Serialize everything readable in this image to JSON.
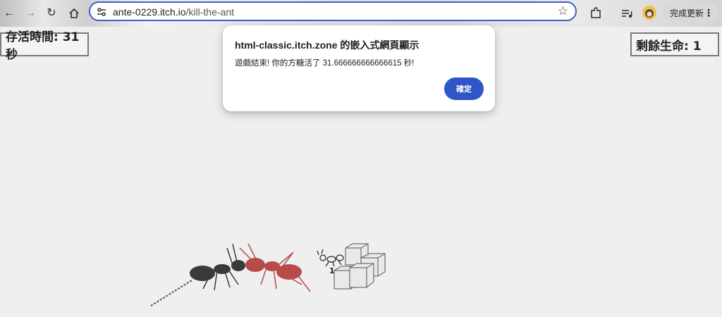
{
  "browser": {
    "url_host": "ante-0229.itch.io",
    "url_path": "/kill-the-ant",
    "update_label": "完成更新",
    "icons": [
      "back-icon",
      "forward-icon",
      "reload-icon",
      "home-icon",
      "site-info-icon",
      "star-icon",
      "extensions-icon",
      "media-queue-icon",
      "profile-avatar",
      "more-icon"
    ]
  },
  "hud": {
    "survival_time": "存活時間: 31秒",
    "lives_left": "剩餘生命: 1"
  },
  "dialog": {
    "title": "html-classic.itch.zone 的嵌入式網頁顯示",
    "message": "遊戲結束! 你的方糖活了 31.666666666666615 秒!",
    "ok_label": "確定"
  },
  "game": {
    "sugar_cube_count_label": "1",
    "colors": {
      "red_ant": "#b84a4a",
      "dark_ant": "#3a3a3a",
      "accent_button": "#2f56c8"
    }
  }
}
